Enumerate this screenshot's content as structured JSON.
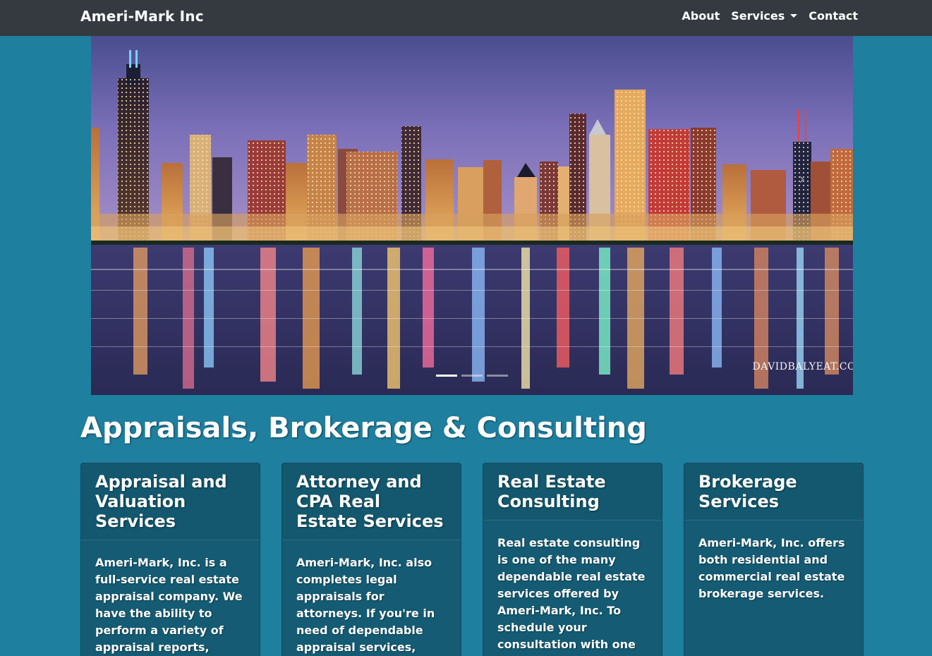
{
  "navbar": {
    "brand": "Ameri-Mark Inc",
    "links": [
      {
        "label": "About"
      },
      {
        "label": "Services"
      },
      {
        "label": "Contact"
      }
    ]
  },
  "carousel": {
    "image_credit": "DAVIDBALYEAT.CO",
    "slide_count": 3,
    "active_slide": 1
  },
  "hero": {
    "heading": "Appraisals, Brokerage & Consulting"
  },
  "cards": [
    {
      "title": "Appraisal and Valuation Services",
      "text": "Ameri-Mark, Inc. is a full-service real estate appraisal company. We have the ability to perform a variety of appraisal reports,"
    },
    {
      "title": "Attorney and CPA Real Estate Services",
      "text": "Ameri-Mark, Inc. also completes legal appraisals for attorneys. If you're in need of dependable appraisal services,"
    },
    {
      "title": "Real Estate Consulting",
      "text": "Real estate consulting is one of the many dependable real estate services offered by Ameri-Mark, Inc. To schedule your consultation with one"
    },
    {
      "title": "Brokerage Services",
      "text": "Ameri-Mark, Inc. offers both residential and commercial real estate brokerage services."
    }
  ],
  "colors": {
    "navbar_bg": "#343a40",
    "page_bg": "#1e7f9f",
    "card_bg": "#145b73"
  }
}
